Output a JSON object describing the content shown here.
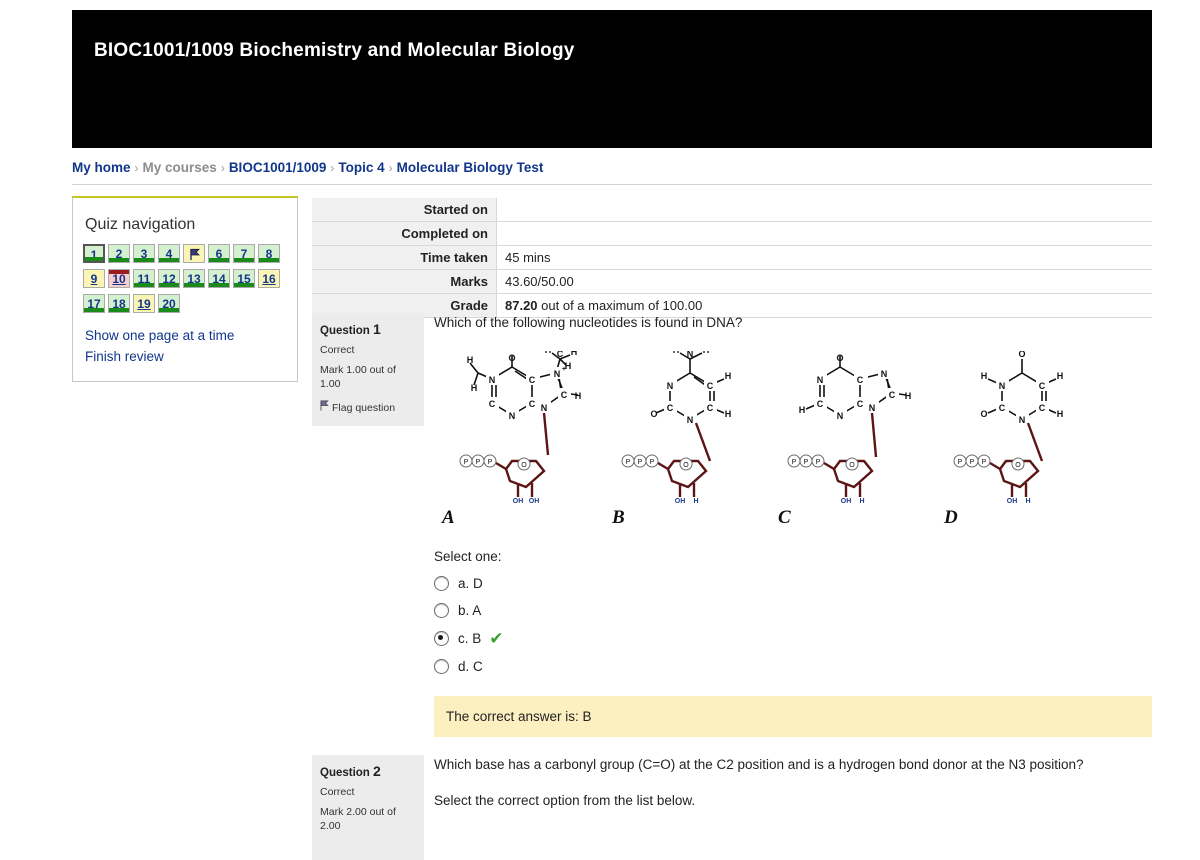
{
  "header": {
    "title": "BIOC1001/1009 Biochemistry and Molecular Biology"
  },
  "breadcrumb": {
    "items": [
      {
        "label": "My home",
        "link": true
      },
      {
        "label": "My courses",
        "link": false
      },
      {
        "label": "BIOC1001/1009",
        "link": true
      },
      {
        "label": "Topic 4",
        "link": true
      },
      {
        "label": "Molecular Biology Test",
        "link": true
      }
    ],
    "separator": "›"
  },
  "quiz_nav": {
    "title": "Quiz navigation",
    "buttons": [
      {
        "label": "1",
        "state": "answered",
        "current": true,
        "bar": "bottom"
      },
      {
        "label": "2",
        "state": "answered",
        "current": false,
        "bar": "bottom"
      },
      {
        "label": "3",
        "state": "answered",
        "current": false,
        "bar": "bottom"
      },
      {
        "label": "4",
        "state": "answered",
        "current": false,
        "bar": "bottom"
      },
      {
        "label": "",
        "state": "notanswered",
        "current": false,
        "bar": "none",
        "icon": "flag-icon"
      },
      {
        "label": "6",
        "state": "answered",
        "current": false,
        "bar": "bottom"
      },
      {
        "label": "7",
        "state": "answered",
        "current": false,
        "bar": "bottom"
      },
      {
        "label": "8",
        "state": "answered",
        "current": false,
        "bar": "bottom"
      },
      {
        "label": "9",
        "state": "notanswered",
        "current": false,
        "bar": "none"
      },
      {
        "label": "10",
        "state": "wrong",
        "current": false,
        "bar": "top"
      },
      {
        "label": "11",
        "state": "answered",
        "current": false,
        "bar": "bottom"
      },
      {
        "label": "12",
        "state": "answered",
        "current": false,
        "bar": "bottom"
      },
      {
        "label": "13",
        "state": "answered",
        "current": false,
        "bar": "bottom"
      },
      {
        "label": "14",
        "state": "answered",
        "current": false,
        "bar": "bottom"
      },
      {
        "label": "15",
        "state": "answered",
        "current": false,
        "bar": "bottom"
      },
      {
        "label": "16",
        "state": "notanswered",
        "current": false,
        "bar": "none"
      },
      {
        "label": "17",
        "state": "answered",
        "current": false,
        "bar": "bottom"
      },
      {
        "label": "18",
        "state": "answered",
        "current": false,
        "bar": "bottom"
      },
      {
        "label": "19",
        "state": "notanswered",
        "current": false,
        "bar": "none"
      },
      {
        "label": "20",
        "state": "answered",
        "current": false,
        "bar": "bottom"
      }
    ],
    "links": [
      {
        "label": "Show one page at a time"
      },
      {
        "label": "Finish review"
      }
    ]
  },
  "summary": {
    "rows": [
      {
        "label": "Started on",
        "value": "",
        "value_bold": "",
        "value_rest": ""
      },
      {
        "label": "Completed on",
        "value": "",
        "value_bold": "",
        "value_rest": ""
      },
      {
        "label": "Time taken",
        "value": "45 mins",
        "value_bold": "",
        "value_rest": "45 mins"
      },
      {
        "label": "Marks",
        "value": "43.60/50.00",
        "value_bold": "",
        "value_rest": "43.60/50.00"
      },
      {
        "label": "Grade",
        "value": "87.20 out of a maximum of 100.00",
        "value_bold": "87.20",
        "value_rest": " out of a maximum of 100.00"
      }
    ]
  },
  "questions": [
    {
      "number_label": "Question",
      "number": "1",
      "state": "Correct",
      "mark": "Mark 1.00 out of 1.00",
      "flag_label": "Flag question",
      "text": "Which of the following nucleotides is found in DNA?",
      "text2": "",
      "select_label": "Select one:",
      "molecules": [
        {
          "label": "A",
          "base": "7-methylguanine",
          "sugar": "ribose",
          "phosphates": "PPP",
          "hydroxyls": [
            "OH",
            "OH"
          ]
        },
        {
          "label": "B",
          "base": "cytosine",
          "sugar": "deoxyribose",
          "phosphates": "PPP",
          "hydroxyls": [
            "OH",
            "H"
          ]
        },
        {
          "label": "C",
          "base": "hypoxanthine",
          "sugar": "deoxyribose",
          "phosphates": "PPP",
          "hydroxyls": [
            "OH",
            "H"
          ]
        },
        {
          "label": "D",
          "base": "uracil",
          "sugar": "deoxyribose",
          "phosphates": "PPP",
          "hydroxyls": [
            "OH",
            "H"
          ]
        }
      ],
      "options": [
        {
          "key": "a.",
          "text": "D",
          "selected": false,
          "correct": false
        },
        {
          "key": "b.",
          "text": "A",
          "selected": false,
          "correct": false
        },
        {
          "key": "c.",
          "text": "B",
          "selected": true,
          "correct": true
        },
        {
          "key": "d.",
          "text": "C",
          "selected": false,
          "correct": false
        }
      ],
      "feedback": "The correct answer is: B"
    },
    {
      "number_label": "Question",
      "number": "2",
      "state": "Correct",
      "mark": "Mark 2.00 out of 2.00",
      "flag_label": "",
      "text": "Which base has a carbonyl group (C=O) at the C2 position and is a hydrogen bond donor at the N3 position?",
      "text2": "Select the correct option from the list below."
    }
  ],
  "colors": {
    "answered": "#d5f0cf",
    "not_answered": "#fbf5b5",
    "wrong": "#f7cdd0",
    "correct_bar": "#1a8a1a",
    "wrong_bar": "#9b1c1c",
    "feedback_bg": "#fcefc0",
    "accent_top": "#c2c62b",
    "link": "#11368a",
    "tick": "#3aa130"
  },
  "icons": {
    "flag": "⚑",
    "check": "✔"
  }
}
